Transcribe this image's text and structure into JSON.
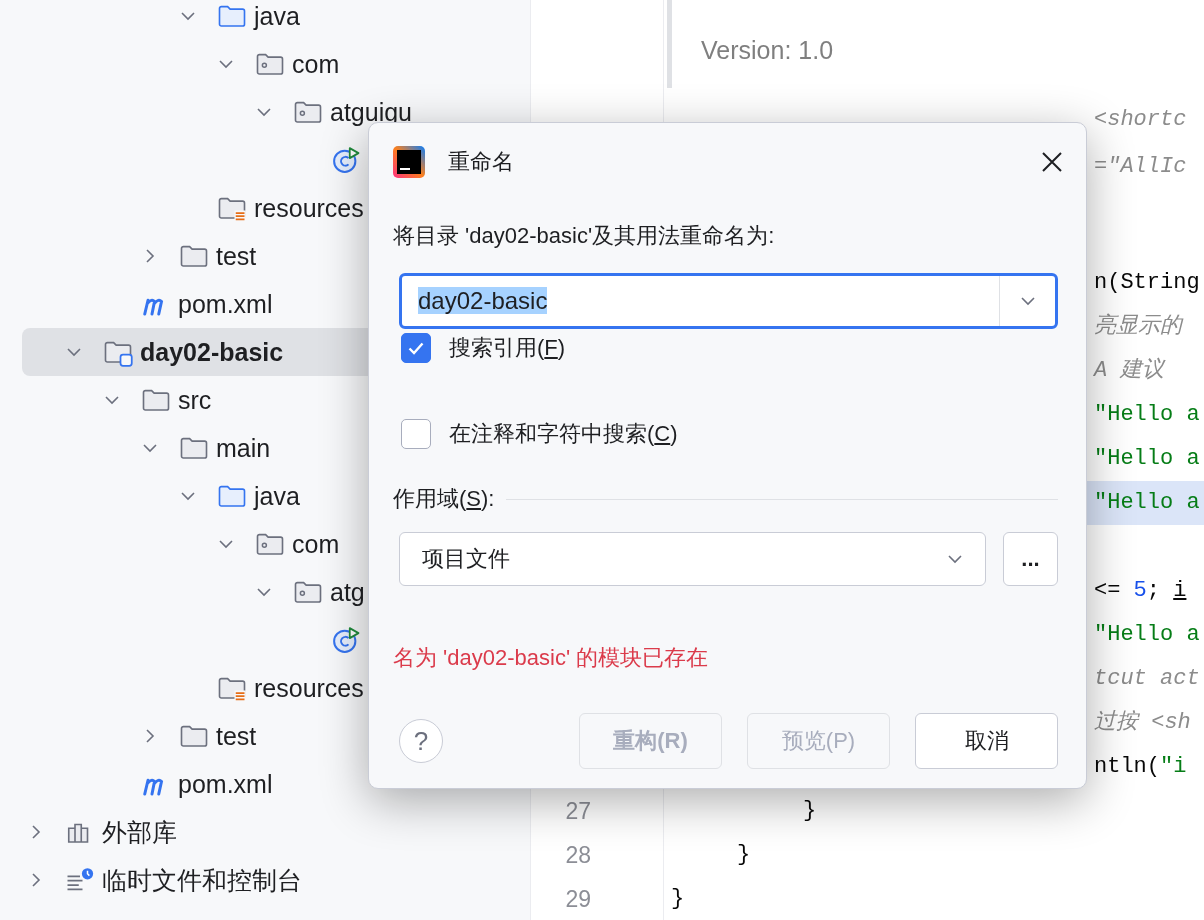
{
  "project_tree": {
    "items": [
      {
        "children": [
          {
            "children": [
              {
                "children": [
                  {
                    "children": [
                      {
                        "label": "java",
                        "kind": "source-folder",
                        "expanded": true,
                        "selected": false,
                        "children": [
                          {
                            "label": "com",
                            "kind": "package",
                            "expanded": true,
                            "selected": false,
                            "children": [
                              {
                                "label": "atguigu",
                                "kind": "package",
                                "expanded": true,
                                "selected": false,
                                "children": [
                                  {
                                    "kind": "run-class",
                                    "selected": false
                                  }
                                ]
                              }
                            ]
                          }
                        ]
                      },
                      {
                        "label": "resources",
                        "kind": "resources",
                        "selected": false
                      }
                    ]
                  },
                  {
                    "label": "test",
                    "kind": "folder",
                    "expanded": false,
                    "selected": false
                  }
                ]
              },
              {
                "label": "pom.xml",
                "kind": "maven",
                "selected": false
              }
            ]
          },
          {
            "label": "day02-basic",
            "kind": "module",
            "expanded": true,
            "selected": true,
            "children": [
              {
                "label": "src",
                "kind": "folder",
                "expanded": true,
                "selected": false,
                "children": [
                  {
                    "label": "main",
                    "kind": "folder",
                    "expanded": true,
                    "selected": false,
                    "children": [
                      {
                        "label": "java",
                        "kind": "source-folder",
                        "expanded": true,
                        "selected": false,
                        "children": [
                          {
                            "label": "com",
                            "kind": "package",
                            "expanded": true,
                            "selected": false,
                            "children": [
                              {
                                "label": "atg",
                                "kind": "package",
                                "expanded": true,
                                "selected": false,
                                "children": [
                                  {
                                    "kind": "run-class",
                                    "selected": false
                                  }
                                ]
                              }
                            ]
                          }
                        ]
                      },
                      {
                        "label": "resources",
                        "kind": "resources",
                        "selected": false
                      }
                    ]
                  },
                  {
                    "label": "test",
                    "kind": "folder",
                    "expanded": false,
                    "selected": false
                  }
                ]
              },
              {
                "label": "pom.xml",
                "kind": "maven",
                "selected": false
              }
            ]
          }
        ]
      },
      {
        "label": "外部库",
        "kind": "library",
        "expanded": false,
        "selected": false
      },
      {
        "label": "临时文件和控制台",
        "kind": "scratch",
        "expanded": false,
        "selected": false
      }
    ]
  },
  "editor": {
    "doc": "Version: 1.0",
    "lines": [
      {
        "kind": "fragment",
        "current": false,
        "tokens": [
          {
            "text": "<shortc",
            "kind": "comment"
          }
        ]
      },
      {
        "kind": "fragment",
        "current": false,
        "tokens": [
          {
            "text": "=\"AllIc",
            "kind": "comment"
          }
        ]
      },
      {
        "kind": "fragment",
        "current": false,
        "tokens": [
          {
            "text": "n(String",
            "kind": "plain"
          }
        ]
      },
      {
        "kind": "fragment",
        "current": false,
        "tokens": [
          {
            "text": "亮显示的",
            "kind": "comment"
          }
        ]
      },
      {
        "kind": "fragment",
        "current": false,
        "tokens": [
          {
            "text": "A 建议",
            "kind": "comment"
          }
        ]
      },
      {
        "kind": "fragment",
        "current": false,
        "tokens": [
          {
            "text": "\"Hello a",
            "kind": "string"
          }
        ]
      },
      {
        "kind": "fragment",
        "current": false,
        "tokens": [
          {
            "text": "\"Hello a",
            "kind": "string"
          }
        ]
      },
      {
        "kind": "fragment",
        "current": true,
        "tokens": [
          {
            "text": "\"Hello a",
            "kind": "string"
          }
        ]
      },
      {
        "kind": "fragment",
        "current": false
      },
      {
        "kind": "fragment",
        "current": false,
        "tokens": [
          {
            "text": "<= ",
            "kind": "plain"
          },
          {
            "text": "5",
            "kind": "number"
          },
          {
            "text": "; ",
            "kind": "plain"
          },
          {
            "text": "i",
            "kind": "variable"
          }
        ]
      },
      {
        "kind": "fragment",
        "current": false,
        "tokens": [
          {
            "text": "\"Hello a",
            "kind": "string"
          }
        ]
      },
      {
        "kind": "fragment",
        "current": false,
        "tokens": [
          {
            "text": "tcut act",
            "kind": "comment"
          }
        ]
      },
      {
        "kind": "fragment",
        "current": false,
        "tokens": [
          {
            "text": "过按 <sh",
            "kind": "comment"
          }
        ]
      },
      {
        "kind": "fragment",
        "current": false,
        "tokens": [
          {
            "text": "ntln(",
            "kind": "plain"
          },
          {
            "text": "\"i",
            "kind": "string"
          }
        ]
      },
      {
        "number": "27",
        "kind": "full",
        "current": false,
        "tokens": [
          {
            "text": "          }",
            "kind": "plain"
          }
        ]
      },
      {
        "number": "28",
        "kind": "full",
        "current": false,
        "tokens": [
          {
            "text": "     }",
            "kind": "plain"
          }
        ]
      },
      {
        "number": "29",
        "kind": "full",
        "current": false,
        "tokens": [
          {
            "text": "}",
            "kind": "plain"
          }
        ]
      }
    ]
  },
  "dialog": {
    "title": "重命名",
    "prompt": "将目录 'day02-basic'及其用法重命名为:",
    "name_field": {
      "value": "day02-basic",
      "text_selected": true
    },
    "options": [
      {
        "before": "搜索引用(",
        "mnemonic": "F",
        "after": ")",
        "checked": true
      },
      {
        "before": "在注释和字符中搜索(",
        "mnemonic": "C",
        "after": ")",
        "checked": false
      }
    ],
    "scope": {
      "label_before": "作用域(",
      "mnemonic": "S",
      "label_after": "):",
      "value": "项目文件",
      "browse": "..."
    },
    "error": "名为 'day02-basic' 的模块已存在",
    "help": "?",
    "buttons": [
      {
        "label": "重构(R)",
        "default": true,
        "disabled": true
      },
      {
        "label": "预览(P)",
        "default": false,
        "disabled": true
      },
      {
        "label": "取消",
        "default": false,
        "disabled": false
      }
    ]
  }
}
